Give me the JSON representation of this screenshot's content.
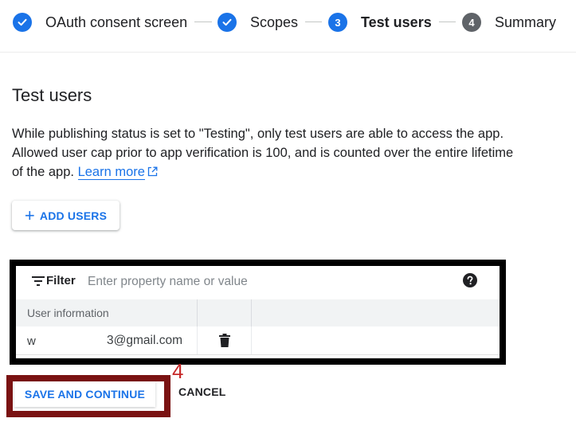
{
  "stepper": {
    "steps": [
      {
        "label": "OAuth consent screen",
        "number": "",
        "state": "done"
      },
      {
        "label": "Scopes",
        "number": "",
        "state": "done"
      },
      {
        "label": "Test users",
        "number": "3",
        "state": "active"
      },
      {
        "label": "Summary",
        "number": "4",
        "state": "todo"
      }
    ]
  },
  "main": {
    "title": "Test users",
    "description": "While publishing status is set to \"Testing\", only test users are able to access the app. Allowed user cap prior to app verification is 100, and is counted over the entire lifetime of the app.",
    "learn_more": "Learn more",
    "add_users": "ADD USERS"
  },
  "table": {
    "filter_label": "Filter",
    "filter_placeholder": "Enter property name or value",
    "column_header": "User information",
    "rows": [
      {
        "email_start": "w",
        "email_end": "3@gmail.com"
      }
    ]
  },
  "actions": {
    "save_continue": "SAVE AND CONTINUE",
    "cancel": "CANCEL"
  },
  "annotation": {
    "label": "4"
  },
  "colors": {
    "accent": "#1a73e8",
    "inactive_step": "#5f6368",
    "highlight_table": "#000000",
    "highlight_save": "#7a1212",
    "annotation": "#c62828"
  },
  "icons": [
    "check-icon",
    "filter-icon",
    "help-icon",
    "trash-icon",
    "external-link-icon",
    "plus-icon"
  ]
}
